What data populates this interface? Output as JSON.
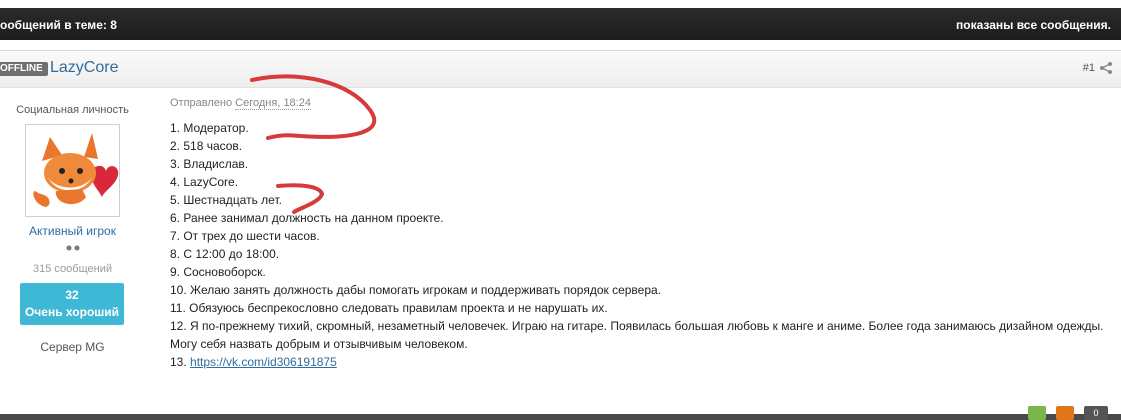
{
  "topbar": {
    "messages_in_topic": "ообщений в теме: 8",
    "shown_all": "показаны все сообщения."
  },
  "post": {
    "status_badge": "OFFLINE",
    "author": "LazyCore",
    "number": "#1",
    "posted_label": "Отправлено",
    "posted_date": "Сегодня, 18:24",
    "lines": [
      "1. Модератор.",
      "2. 518 часов.",
      "3. Владислав.",
      "4. LazyCore.",
      "5. Шестнадцать лет.",
      "6. Ранее занимал должность на данном проекте.",
      "7. От трех до шести часов.",
      "8. С 12:00  до 18:00.",
      "9. Сосновоборск.",
      "10. Желаю занять должность дабы помогать игрокам и поддерживать порядок сервера.",
      "11. Обязуюсь беспрекословно следовать правилам проекта и не нарушать их.",
      "12. Я по-прежнему тихий, скромный, незаметный человечек. Играю на гитаре. Появилась большая любовь к манге и аниме. Более года занимаюсь дизайном одежды.",
      "Могу себя назвать добрым и отзывчивым человеком."
    ],
    "link_prefix": "13. ",
    "link_text": "https://vk.com/id306191875"
  },
  "sidebar": {
    "user_title": "Социальная личность",
    "rank": "Активный игрок",
    "message_count": "315 сообщений",
    "reputation_value": "32",
    "reputation_label": "Очень хороший",
    "server": "Сервер MG"
  },
  "bottom": {
    "counter": "0"
  },
  "colors": {
    "link": "#2f6d9e",
    "reputation_bg": "#3fb8d6",
    "annotation_red": "#d63a3a"
  }
}
